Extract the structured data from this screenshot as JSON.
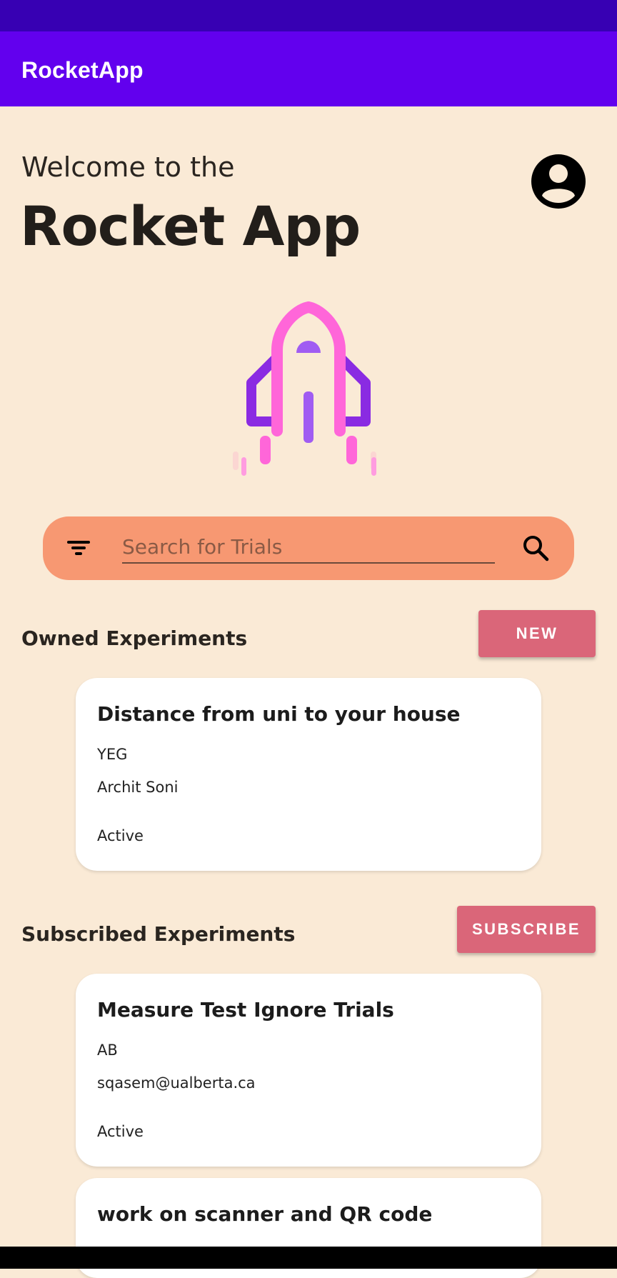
{
  "app_bar": {
    "title": "RocketApp"
  },
  "header": {
    "welcome": "Welcome to the",
    "app_name": "Rocket App",
    "avatar_icon": "account-circle-icon"
  },
  "search": {
    "placeholder": "Search for Trials",
    "value": "",
    "filter_icon": "filter-icon",
    "search_icon": "search-icon"
  },
  "owned": {
    "title": "Owned Experiments",
    "button_label": "NEW",
    "experiments": [
      {
        "title": "Distance from uni to your house",
        "region": "YEG",
        "owner": "Archit Soni",
        "status": "Active"
      }
    ]
  },
  "subscribed": {
    "title": "Subscribed Experiments",
    "button_label": "SUBSCRIBE",
    "experiments": [
      {
        "title": "Measure Test Ignore Trials",
        "region": "AB",
        "owner": "sqasem@ualberta.ca",
        "status": "Active"
      },
      {
        "title": "work on scanner and QR code",
        "region": "",
        "owner": "",
        "status": ""
      }
    ]
  },
  "colors": {
    "status_bar": "#3700b3",
    "app_bar": "#6200ee",
    "background": "#faead6",
    "search_bar": "#f79872",
    "button": "#da6679",
    "rocket_pink": "#ff66d9",
    "rocket_purple": "#8a2be2"
  }
}
